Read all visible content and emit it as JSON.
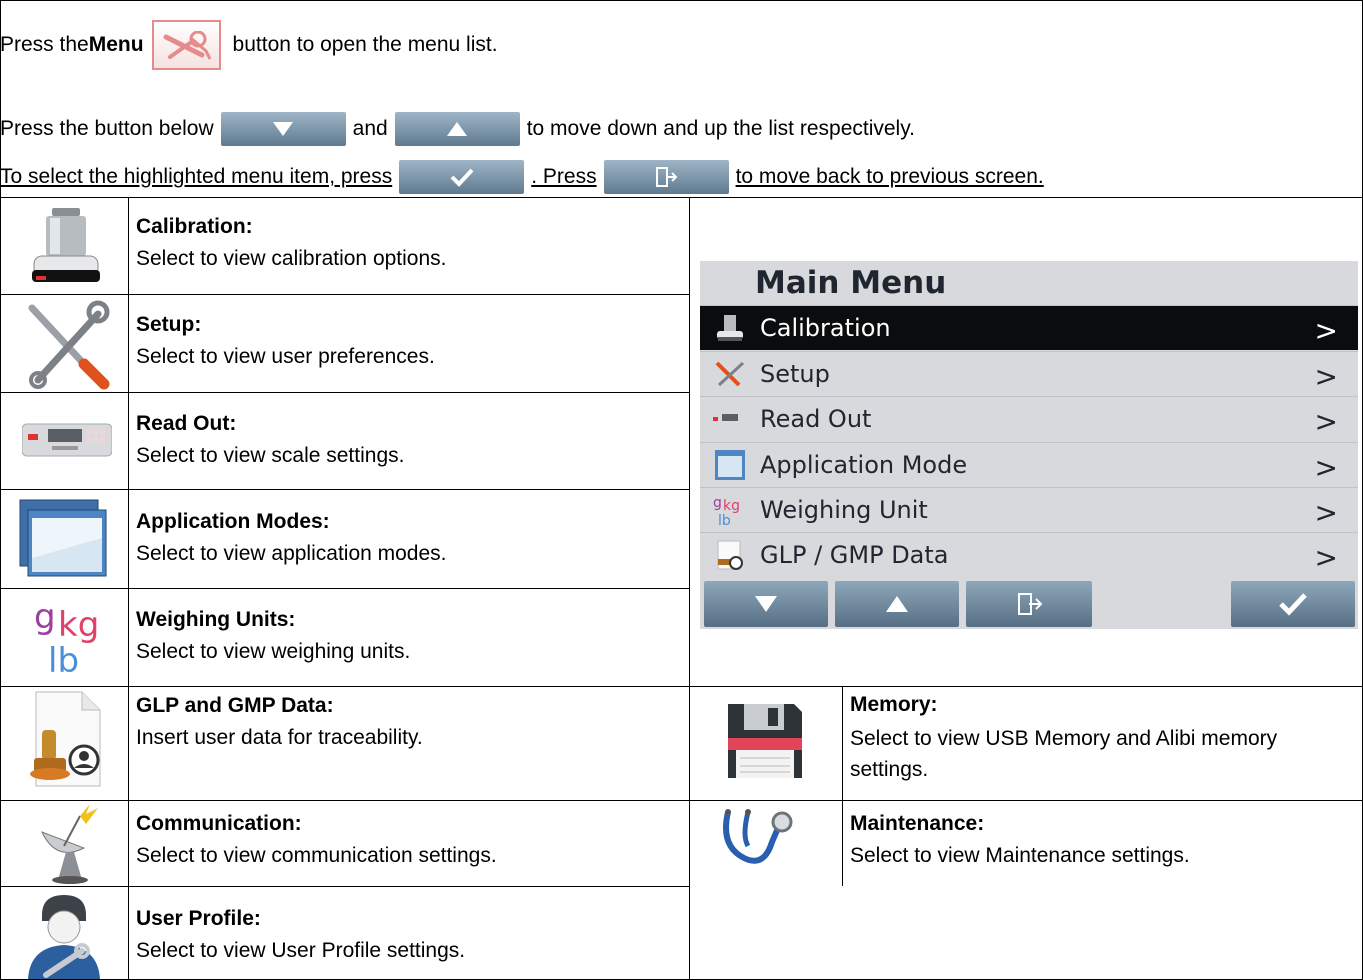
{
  "intro": {
    "line1_pre": "Press the ",
    "line1_bold": "Menu",
    "line1_post": "button to open the menu list.",
    "line2_pre": "Press the button below",
    "line2_mid": "and",
    "line2_post": "to move down and up the list respectively.",
    "line3_pre": "To select the highlighted menu item, press",
    "line3_mid": ". Press",
    "line3_post": "to move back to previous screen."
  },
  "items": [
    {
      "title": "Calibration:",
      "desc": "Select to view calibration options.",
      "icon": "calibration-weight-icon"
    },
    {
      "title": "Setup:",
      "desc": "Select to view user preferences.",
      "icon": "setup-tools-icon"
    },
    {
      "title": "Read Out:",
      "desc": "Select to view scale settings.",
      "icon": "readout-display-icon"
    },
    {
      "title": "Application Modes:",
      "desc": "Select to view application modes.",
      "icon": "application-windows-icon"
    },
    {
      "title": "Weighing Units:",
      "desc": "Select to view weighing units.",
      "icon": "weighing-units-icon"
    },
    {
      "title": "GLP and GMP Data:",
      "desc": "Insert user data for traceability.",
      "icon": "glp-document-stamp-icon"
    },
    {
      "title": "Communication:",
      "desc": "Select to view communication settings.",
      "icon": "satellite-dish-icon"
    },
    {
      "title": "User Profile:",
      "desc": "Select to view User Profile settings.",
      "icon": "user-profile-icon"
    },
    {
      "title": "Memory:",
      "desc": "Select to view USB Memory and Alibi memory settings.",
      "icon": "floppy-disk-icon"
    },
    {
      "title": "Maintenance:",
      "desc": "Select to view Maintenance settings.",
      "icon": "stethoscope-icon"
    }
  ],
  "main_menu": {
    "title": "Main Menu",
    "rows": [
      {
        "label": "Calibration",
        "selected": true
      },
      {
        "label": "Setup",
        "selected": false
      },
      {
        "label": "Read Out",
        "selected": false
      },
      {
        "label": "Application Mode",
        "selected": false
      },
      {
        "label": "Weighing Unit",
        "selected": false
      },
      {
        "label": "GLP / GMP Data",
        "selected": false
      }
    ],
    "chevron": ">"
  },
  "colors": {
    "key_top": "#9fb5c6",
    "key_bottom": "#5f7a90",
    "menu_btn_border": "#e58b8b",
    "selected_row": "#0b0c0e",
    "screen_bg": "#d7d9dc",
    "memory_red": "#e0455a"
  }
}
